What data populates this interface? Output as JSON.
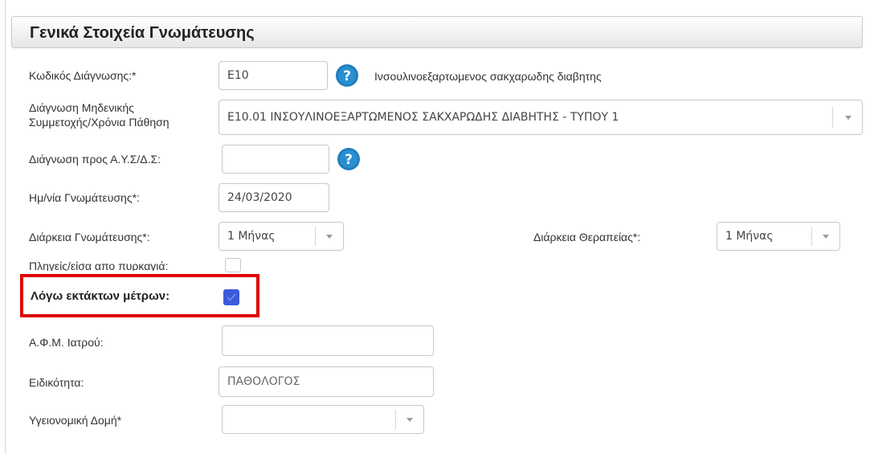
{
  "panel": {
    "title": "Γενικά Στοιχεία Γνωμάτευσης"
  },
  "diagnosis_code": {
    "label": "Κωδικός Διάγνωσης:*",
    "value": "E10",
    "description": "Ινσουλινοεξαρτωμενος σακχαρωδης διαβητης",
    "help_icon": "question-circle-icon"
  },
  "zero_participation": {
    "label_line1": "Διάγνωση Μηδενικής",
    "label_line2": "Συμμετοχής/Χρόνια Πάθηση",
    "selected": "E10.01 ΙΝΣΟΥΛΙΝΟΕΞΑΡΤΩΜΕΝΟΣ ΣΑΚΧΑΡΩΔΗΣ ΔΙΑΒΗΤΗΣ - ΤΥΠΟΥ 1"
  },
  "ays_diagnosis": {
    "label": "Διάγνωση προς Α.Υ.Σ/Δ.Σ:",
    "value": "",
    "help_icon": "question-circle-icon"
  },
  "opinion_date": {
    "label": "Ημ/νία Γνωμάτευσης*:",
    "value": "24/03/2020"
  },
  "opinion_duration": {
    "label": "Διάρκεια Γνωμάτευσης*:",
    "selected": "1 Μήνας"
  },
  "therapy_duration": {
    "label": "Διάρκεια Θεραπείας*:",
    "selected": "1 Μήνας"
  },
  "fire_victim": {
    "label": "Πληγείς/είσα απο πυρκαγιά:",
    "checked": false
  },
  "emergency_measures": {
    "label": "Λόγω εκτάκτων μέτρων:",
    "checked": true,
    "highlight_color": "#e00000"
  },
  "doctor_afm": {
    "label": "Α.Φ.Μ. Ιατρού:",
    "value": ""
  },
  "specialty": {
    "label": "Ειδικότητα:",
    "value": "ΠΑΘΟΛΟΓΟΣ"
  },
  "health_unit": {
    "label": "Υγειονομική Δομή*",
    "selected": ""
  },
  "colors": {
    "help_icon": "#1f7fbf",
    "checkbox_checked": "#3b5bdb",
    "highlight": "#e00000"
  }
}
